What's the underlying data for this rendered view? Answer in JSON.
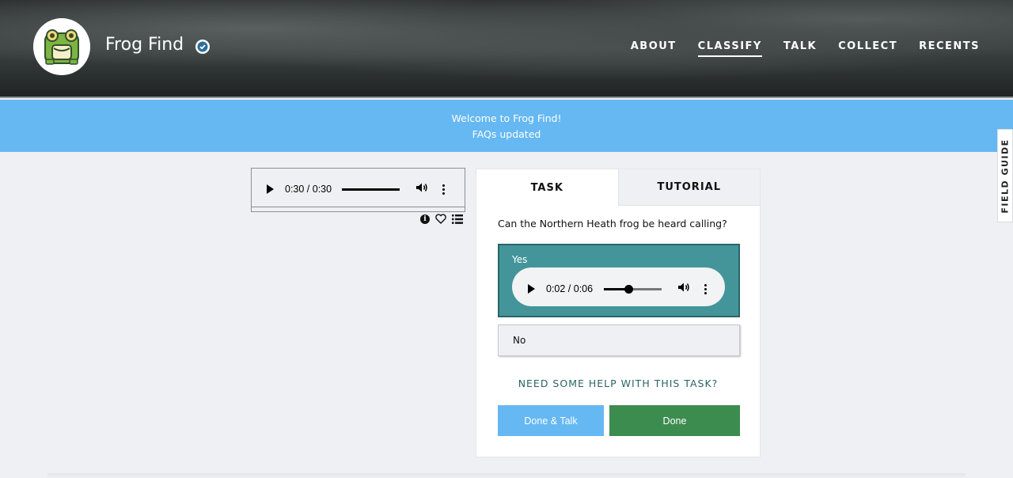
{
  "header": {
    "project_title": "Frog Find",
    "nav": [
      "ABOUT",
      "CLASSIFY",
      "TALK",
      "COLLECT",
      "RECENTS"
    ],
    "active_nav": "CLASSIFY"
  },
  "announcement": {
    "line1": "Welcome to Frog Find!",
    "line2": "FAQs updated"
  },
  "field_guide": {
    "label": "FIELD GUIDE"
  },
  "subject": {
    "audio_time": "0:30 / 0:30",
    "audio_progress": 1.0
  },
  "task_panel": {
    "tabs": [
      "TASK",
      "TUTORIAL"
    ],
    "active_tab": "TASK",
    "question": "Can the Northern Heath frog be heard calling?",
    "answers": [
      {
        "label": "Yes",
        "selected": true,
        "audio_time": "0:02 / 0:06",
        "audio_progress": 0.33
      },
      {
        "label": "No",
        "selected": false
      }
    ],
    "help_link": "NEED SOME HELP WITH THIS TASK?",
    "done_talk_label": "Done & Talk",
    "done_label": "Done"
  },
  "colors": {
    "announcement_bg": "#65b8f2",
    "selected_answer_bg": "#43959a",
    "done_button": "#3c8c50",
    "done_talk_button": "#65b8f2"
  },
  "icons": [
    "frog-logo",
    "verified-check-icon",
    "play-icon",
    "volume-icon",
    "more-options-icon",
    "info-icon",
    "heart-icon",
    "list-icon"
  ]
}
